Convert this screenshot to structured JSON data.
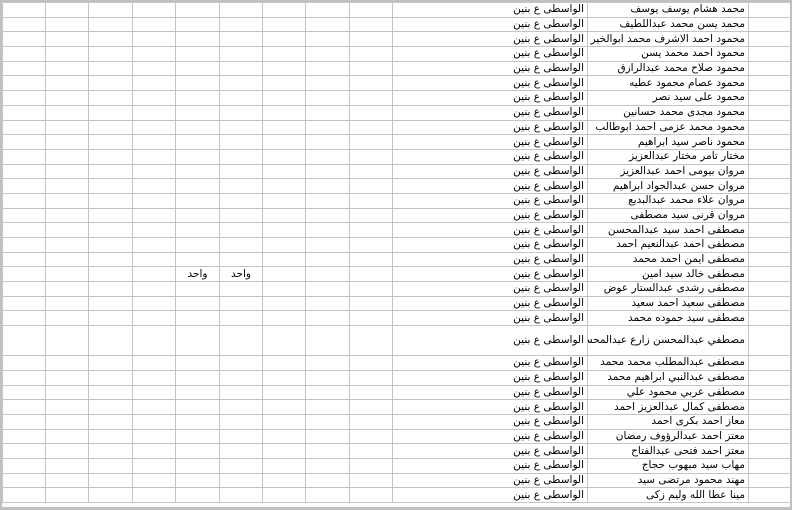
{
  "sheet": {
    "rows": [
      {
        "name": "محمد هشام يوسف يوسف",
        "school": "الواسطى ع بنين",
        "extra": [
          "",
          "",
          "",
          "",
          "",
          "",
          "",
          "",
          ""
        ]
      },
      {
        "name": "محمد يسن محمد عبداللطيف",
        "school": "الواسطى ع بنين",
        "extra": [
          "",
          "",
          "",
          "",
          "",
          "",
          "",
          "",
          ""
        ]
      },
      {
        "name": "محمود احمد الاشرف محمد ابوالخير",
        "school": "الواسطى ع بنين",
        "extra": [
          "",
          "",
          "",
          "",
          "",
          "",
          "",
          "",
          ""
        ]
      },
      {
        "name": "محمود احمد محمد يسن",
        "school": "الواسطى ع بنين",
        "extra": [
          "",
          "",
          "",
          "",
          "",
          "",
          "",
          "",
          ""
        ]
      },
      {
        "name": "محمود صلاح محمد عبدالرازق",
        "school": "الواسطى ع بنين",
        "extra": [
          "",
          "",
          "",
          "",
          "",
          "",
          "",
          "",
          ""
        ]
      },
      {
        "name": "محمود عصام محمود عطيه",
        "school": "الواسطى ع بنين",
        "extra": [
          "",
          "",
          "",
          "",
          "",
          "",
          "",
          "",
          ""
        ]
      },
      {
        "name": "محمود على سيد نصر",
        "school": "الواسطى ع بنين",
        "extra": [
          "",
          "",
          "",
          "",
          "",
          "",
          "",
          "",
          ""
        ]
      },
      {
        "name": "محمود مجدى محمد حسانين",
        "school": "الواسطى ع بنين",
        "extra": [
          "",
          "",
          "",
          "",
          "",
          "",
          "",
          "",
          ""
        ]
      },
      {
        "name": "محمود محمد عزمى احمد ابوطالب",
        "school": "الواسطى ع بنين",
        "extra": [
          "",
          "",
          "",
          "",
          "",
          "",
          "",
          "",
          ""
        ]
      },
      {
        "name": "محمود ناصر سيد ابراهيم",
        "school": "الواسطى ع بنين",
        "extra": [
          "",
          "",
          "",
          "",
          "",
          "",
          "",
          "",
          ""
        ]
      },
      {
        "name": "مختار تامر مختار عبدالعزيز",
        "school": "الواسطى ع بنين",
        "extra": [
          "",
          "",
          "",
          "",
          "",
          "",
          "",
          "",
          ""
        ]
      },
      {
        "name": "مروان بيومى احمد عبدالعزيز",
        "school": "الواسطى ع بنين",
        "extra": [
          "",
          "",
          "",
          "",
          "",
          "",
          "",
          "",
          ""
        ]
      },
      {
        "name": "مروان حسن عبدالجواد ابراهيم",
        "school": "الواسطى ع بنين",
        "extra": [
          "",
          "",
          "",
          "",
          "",
          "",
          "",
          "",
          ""
        ]
      },
      {
        "name": "مروان علاء محمد عبدالبديع",
        "school": "الواسطى ع بنين",
        "extra": [
          "",
          "",
          "",
          "",
          "",
          "",
          "",
          "",
          ""
        ]
      },
      {
        "name": "مروان قرنى سيد مصطفى",
        "school": "الواسطى ع بنين",
        "extra": [
          "",
          "",
          "",
          "",
          "",
          "",
          "",
          "",
          ""
        ]
      },
      {
        "name": "مصطفى احمد سيد عبدالمحسن",
        "school": "الواسطى ع بنين",
        "extra": [
          "",
          "",
          "",
          "",
          "",
          "",
          "",
          "",
          ""
        ]
      },
      {
        "name": "مصطفى احمد عبدالنعيم احمد",
        "school": "الواسطى ع بنين",
        "extra": [
          "",
          "",
          "",
          "",
          "",
          "",
          "",
          "",
          ""
        ]
      },
      {
        "name": "مصطفى ايمن احمد محمد",
        "school": "الواسطى ع بنين",
        "extra": [
          "",
          "",
          "",
          "",
          "",
          "",
          "",
          "",
          ""
        ]
      },
      {
        "name": "مصطفى خالد سيد امين",
        "school": "الواسطى ع بنين",
        "extra": [
          "",
          "",
          "",
          "",
          "واحد",
          "واحد",
          "",
          "",
          ""
        ]
      },
      {
        "name": "مصطفى رشدى عبدالستار عوض",
        "school": "الواسطى ع بنين",
        "extra": [
          "",
          "",
          "",
          "",
          "",
          "",
          "",
          "",
          ""
        ]
      },
      {
        "name": "مصطفى سعيد احمد سعيد",
        "school": "الواسطى ع بنين",
        "extra": [
          "",
          "",
          "",
          "",
          "",
          "",
          "",
          "",
          ""
        ]
      },
      {
        "name": "مصطفى سيد حموده محمد",
        "school": "الواسطى ع بنين",
        "extra": [
          "",
          "",
          "",
          "",
          "",
          "",
          "",
          "",
          ""
        ]
      },
      {
        "name": "مصطفي عبدالمحسن زارع عبدالمحسن",
        "school": "الواسطى ع بنين",
        "extra": [
          "",
          "",
          "",
          "",
          "",
          "",
          "",
          "",
          ""
        ],
        "tall": true
      },
      {
        "name": "مصطفى عبدالمطلب محمد محمد",
        "school": "الواسطى ع بنين",
        "extra": [
          "",
          "",
          "",
          "",
          "",
          "",
          "",
          "",
          ""
        ]
      },
      {
        "name": "مصطفى عبدالنبي ابراهيم محمد",
        "school": "الواسطى ع بنين",
        "extra": [
          "",
          "",
          "",
          "",
          "",
          "",
          "",
          "",
          ""
        ]
      },
      {
        "name": "مصطفى عربي محمود علي",
        "school": "الواسطى ع بنين",
        "extra": [
          "",
          "",
          "",
          "",
          "",
          "",
          "",
          "",
          ""
        ]
      },
      {
        "name": "مصطفى كمال عبدالعزيز احمد",
        "school": "الواسطى ع بنين",
        "extra": [
          "",
          "",
          "",
          "",
          "",
          "",
          "",
          "",
          ""
        ]
      },
      {
        "name": "معاز احمد بكرى احمد",
        "school": "الواسطى ع بنين",
        "extra": [
          "",
          "",
          "",
          "",
          "",
          "",
          "",
          "",
          ""
        ]
      },
      {
        "name": "معتز احمد عبدالرؤوف رمضان",
        "school": "الواسطى ع بنين",
        "extra": [
          "",
          "",
          "",
          "",
          "",
          "",
          "",
          "",
          ""
        ]
      },
      {
        "name": "معتز احمد فتحى عبدالفتاح",
        "school": "الواسطى ع بنين",
        "extra": [
          "",
          "",
          "",
          "",
          "",
          "",
          "",
          "",
          ""
        ]
      },
      {
        "name": "مهاب سيد مبهوب حجاج",
        "school": "الواسطى ع بنين",
        "extra": [
          "",
          "",
          "",
          "",
          "",
          "",
          "",
          "",
          ""
        ]
      },
      {
        "name": "مهند محمود مرتضى سيد",
        "school": "الواسطى ع بنين",
        "extra": [
          "",
          "",
          "",
          "",
          "",
          "",
          "",
          "",
          ""
        ]
      },
      {
        "name": "مينا عطا الله وليم زكى",
        "school": "الواسطى ع بنين",
        "extra": [
          "",
          "",
          "",
          "",
          "",
          "",
          "",
          "",
          ""
        ]
      }
    ]
  }
}
